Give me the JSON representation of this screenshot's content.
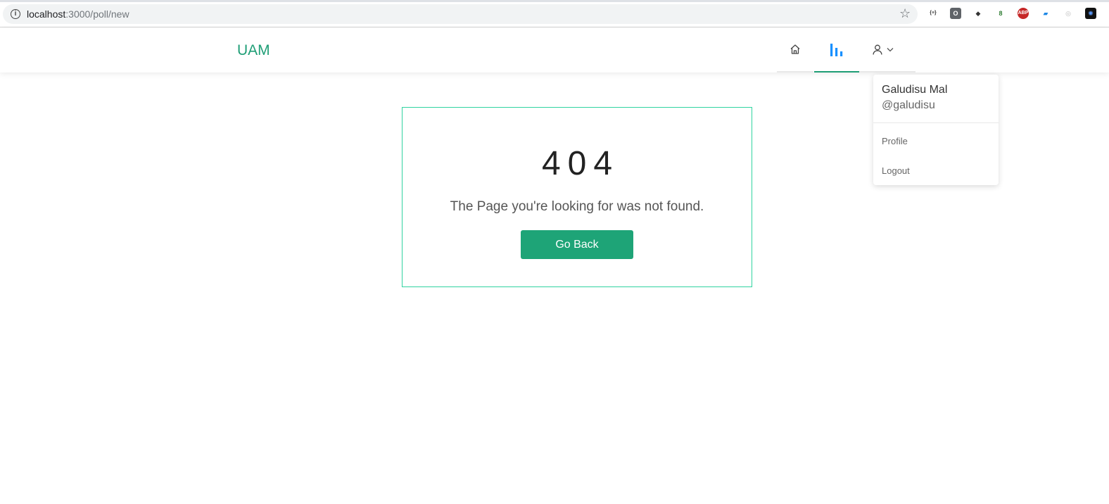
{
  "browser": {
    "url_host": "localhost",
    "url_path": ":3000/poll/new",
    "extensions": [
      {
        "name": "json-extension-icon",
        "glyph": "{≡}",
        "color": "#ffffff",
        "text_color": "#333333"
      },
      {
        "name": "o-extension-icon",
        "glyph": "O",
        "color": "#5f6368",
        "text_color": "#ffffff"
      },
      {
        "name": "cube-extension-icon",
        "glyph": "◆",
        "color": "#ffffff",
        "text_color": "#333333"
      },
      {
        "name": "8-extension-icon",
        "glyph": "8",
        "color": "#ffffff",
        "text_color": "#2e7d32"
      },
      {
        "name": "adblock-extension-icon",
        "glyph": "ABP",
        "color": "#c62828",
        "text_color": "#ffffff"
      },
      {
        "name": "book-extension-icon",
        "glyph": "▰",
        "color": "#ffffff",
        "text_color": "#1e88e5"
      },
      {
        "name": "circle-extension-icon",
        "glyph": "◎",
        "color": "#ffffff",
        "text_color": "#bbbbbb"
      },
      {
        "name": "spark-extension-icon",
        "glyph": "✺",
        "color": "#111111",
        "text_color": "#5b9bff"
      }
    ]
  },
  "header": {
    "brand": "UAM",
    "nav": [
      {
        "id": "home",
        "icon": "home-icon",
        "active": false
      },
      {
        "id": "poll",
        "icon": "bar-chart-icon",
        "active": true
      },
      {
        "id": "user",
        "icon": "user-icon",
        "active": false
      }
    ]
  },
  "dropdown": {
    "name": "Galudisu Mal",
    "handle": "@galudisu",
    "items": [
      "Profile",
      "Logout"
    ]
  },
  "not_found": {
    "code": "404",
    "message": "The Page you're looking for was not found.",
    "button_label": "Go Back"
  },
  "colors": {
    "accent": "#1f9e76",
    "button": "#1ea477",
    "card_border": "#30d3a0",
    "active_icon": "#1890ff"
  }
}
